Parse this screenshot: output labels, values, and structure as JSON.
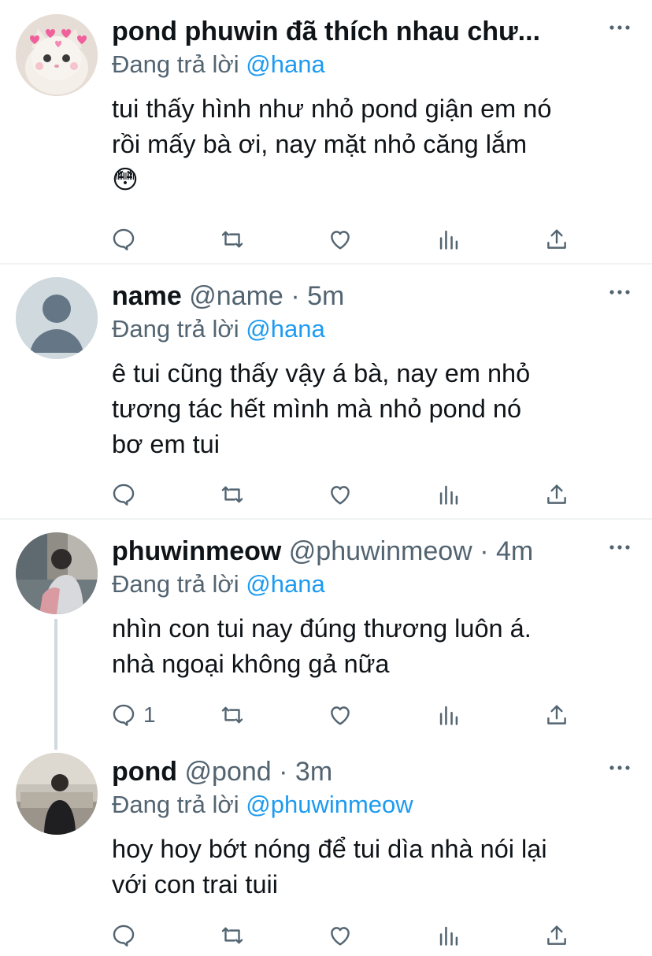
{
  "tweets": [
    {
      "display_name": "pond phuwin đã thích nhau chư...",
      "handle": "",
      "separator": "",
      "time": "",
      "replying_prefix": "Đang trả lời",
      "replying_to": "@hana",
      "lines": [
        "tui thấy hình như nhỏ pond giận em nó",
        "rồi mấy bà ơi, nay mặt nhỏ căng lắm",
        "😳"
      ],
      "reply_count": "",
      "avatar_icon": "cat-avatar-icon"
    },
    {
      "display_name": "name",
      "handle": "@name",
      "separator": "·",
      "time": "5m",
      "replying_prefix": "Đang trả lời",
      "replying_to": "@hana",
      "lines": [
        "ê tui cũng thấy vậy á bà, nay em nhỏ",
        "tương tác hết mình mà nhỏ pond nó",
        "bơ em tui"
      ],
      "reply_count": "",
      "avatar_icon": "default-user-avatar-icon"
    },
    {
      "display_name": "phuwinmeow",
      "handle": "@phuwinmeow",
      "separator": "·",
      "time": "4m",
      "replying_prefix": "Đang trả lời",
      "replying_to": "@hana",
      "lines": [
        "nhìn con tui nay đúng thương luôn á.",
        "nhà ngoại không gả nữa"
      ],
      "reply_count": "1",
      "avatar_icon": "photo-avatar-icon"
    },
    {
      "display_name": "pond",
      "handle": "@pond",
      "separator": "·",
      "time": "3m",
      "replying_prefix": "Đang trả lời",
      "replying_to": "@phuwinmeow",
      "lines": [
        "hoy hoy bớt nóng để tui dìa nhà nói lại",
        "với con trai tuii"
      ],
      "reply_count": "",
      "avatar_icon": "photo-avatar-icon"
    }
  ],
  "colors": {
    "accent": "#1d9bf0",
    "secondary_text": "#536471",
    "divider": "#eff3f4",
    "thread_line": "#cfd9de"
  },
  "action_icons": [
    "reply-icon",
    "retweet-icon",
    "like-icon",
    "analytics-icon",
    "share-icon"
  ]
}
